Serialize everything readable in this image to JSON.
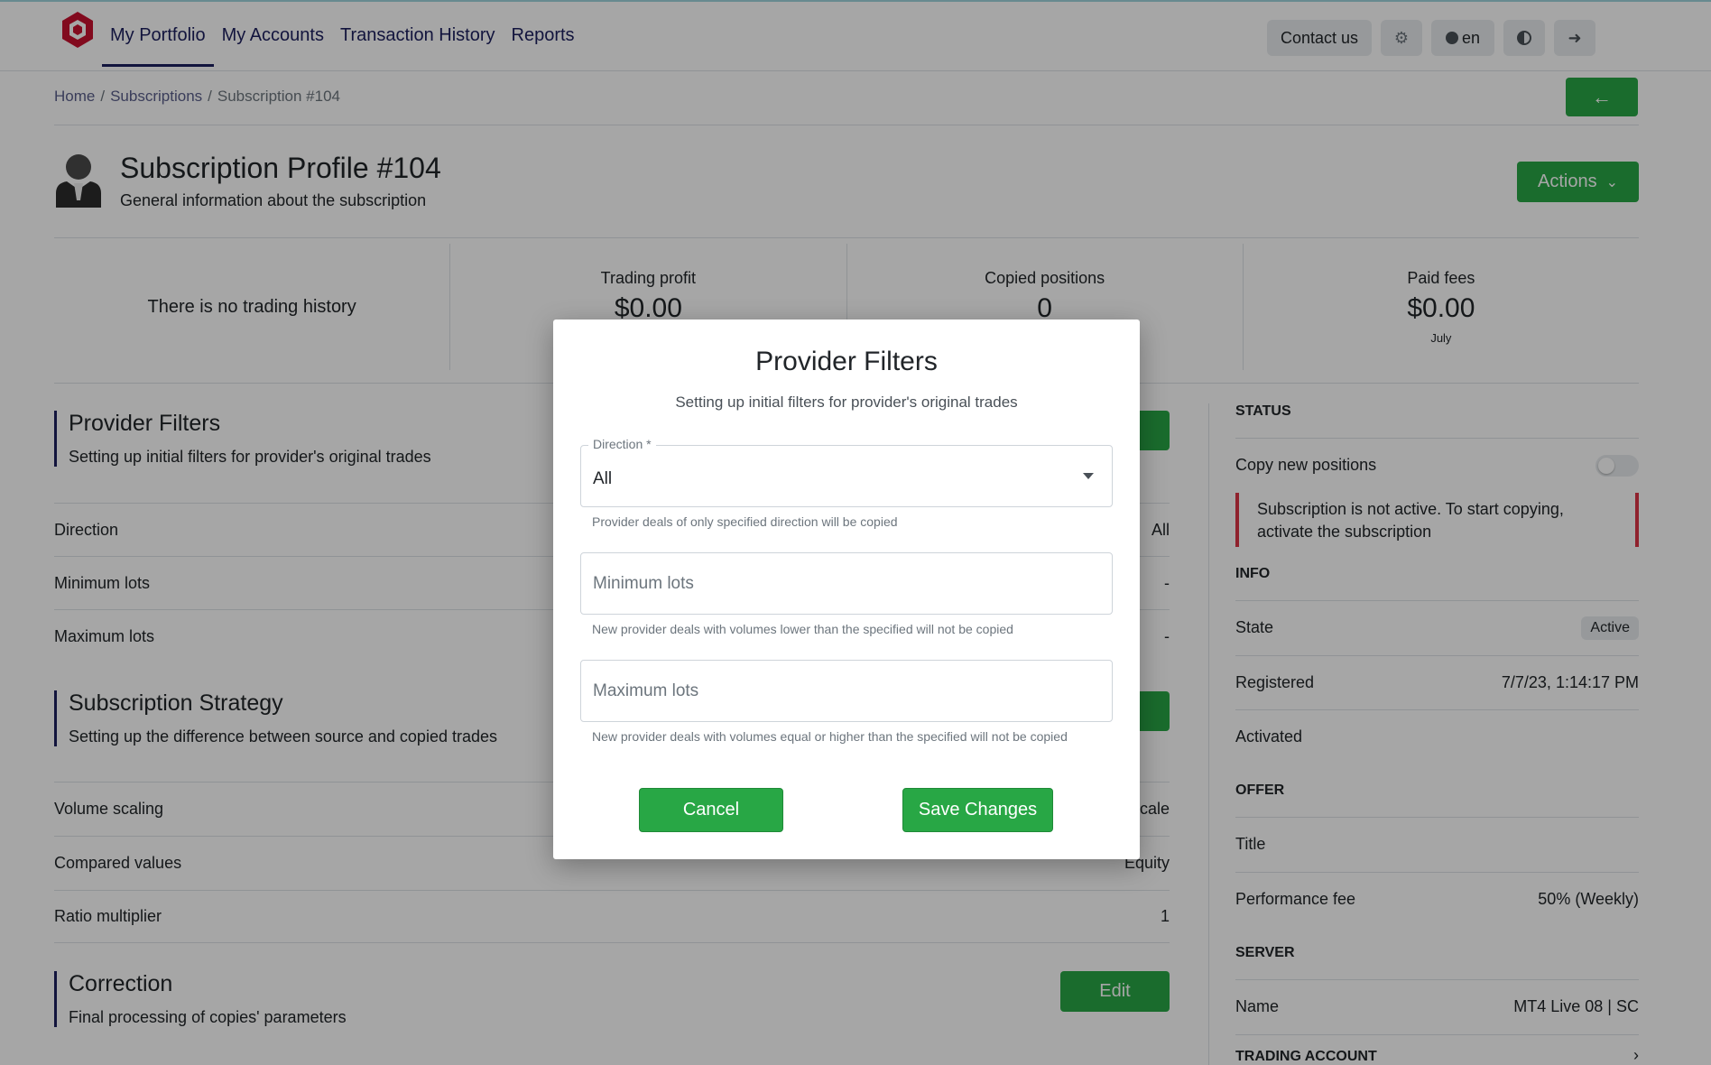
{
  "header": {
    "nav": [
      "My Portfolio",
      "My Accounts",
      "Transaction History",
      "Reports"
    ],
    "contact_label": "Contact us",
    "lang_label": "en"
  },
  "breadcrumb": [
    "Home",
    "Subscriptions",
    "Subscription #104"
  ],
  "profile": {
    "title": "Subscription Profile #104",
    "subtitle": "General information about the subscription",
    "actions_label": "Actions"
  },
  "stats": {
    "no_history": "There is no trading history",
    "trading_profit_label": "Trading profit",
    "trading_profit_value": "$0.00",
    "copied_positions_label": "Copied positions",
    "copied_positions_value": "0",
    "paid_fees_label": "Paid fees",
    "paid_fees_value": "$0.00",
    "paid_fees_period": "July"
  },
  "sections": {
    "filters": {
      "title": "Provider Filters",
      "subtitle": "Setting up initial filters for provider's original trades",
      "rows": [
        {
          "k": "Direction",
          "v": "All"
        },
        {
          "k": "Minimum lots",
          "v": "-"
        },
        {
          "k": "Maximum lots",
          "v": "-"
        }
      ]
    },
    "strategy": {
      "title": "Subscription Strategy",
      "subtitle": "Setting up the difference between source and copied trades",
      "rows": [
        {
          "k": "Volume scaling",
          "v": "cale"
        },
        {
          "k": "Compared values",
          "v": "Equity"
        },
        {
          "k": "Ratio multiplier",
          "v": "1"
        }
      ]
    },
    "correction": {
      "title": "Correction",
      "subtitle": "Final processing of copies' parameters",
      "edit_label": "Edit"
    }
  },
  "right_panel": {
    "status_head": "STATUS",
    "copy_new_label": "Copy new positions",
    "alert": "Subscription is not active. To start copying, activate the subscription",
    "info_head": "INFO",
    "state_label": "State",
    "state_value": "Active",
    "registered_label": "Registered",
    "registered_value": "7/7/23, 1:14:17 PM",
    "activated_label": "Activated",
    "offer_head": "OFFER",
    "title_label": "Title",
    "perf_label": "Performance fee",
    "perf_value": "50% (Weekly)",
    "server_head": "SERVER",
    "name_label": "Name",
    "name_value": "MT4 Live 08 | SC",
    "trading_head": "TRADING ACCOUNT"
  },
  "modal": {
    "title": "Provider Filters",
    "subtitle": "Setting up initial filters for provider's original trades",
    "direction_label": "Direction *",
    "direction_value": "All",
    "direction_hint": "Provider deals of only specified direction will be copied",
    "min_placeholder": "Minimum lots",
    "min_hint": "New provider deals with volumes lower than the specified will not be copied",
    "max_placeholder": "Maximum lots",
    "max_hint": "New provider deals with volumes equal or higher than the specified will not be copied",
    "cancel_label": "Cancel",
    "save_label": "Save Changes"
  },
  "colors": {
    "accent_green": "#28a745",
    "nav_navy": "#1c1f5e",
    "logo_red": "#c8102e",
    "alert_red": "#dc3545"
  }
}
